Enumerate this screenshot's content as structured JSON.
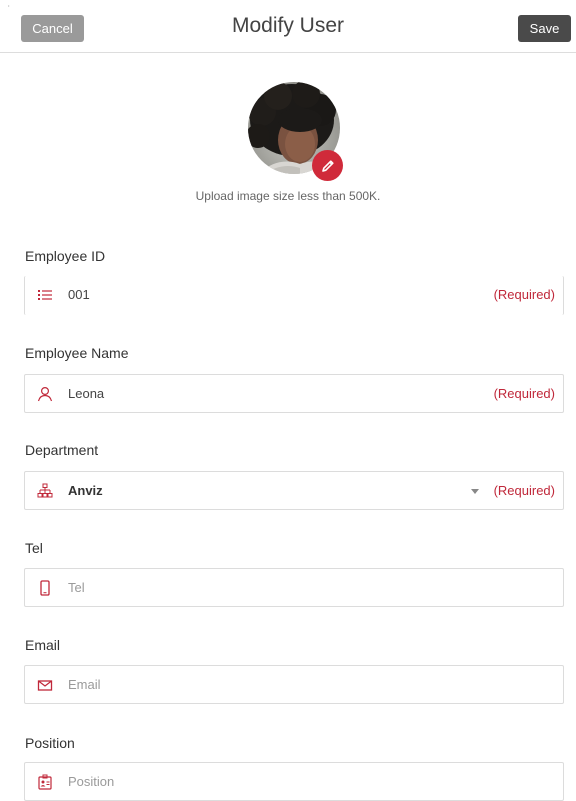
{
  "header": {
    "title": "Modify User",
    "cancel_label": "Cancel",
    "save_label": "Save"
  },
  "avatar": {
    "upload_hint": "Upload image size less than 500K.",
    "edit_icon": "pencil-icon"
  },
  "fields": {
    "employee_id": {
      "label": "Employee ID",
      "value": "001",
      "required": "(Required)",
      "icon": "list-icon"
    },
    "employee_name": {
      "label": "Employee Name",
      "value": "Leona",
      "required": "(Required)",
      "icon": "user-icon"
    },
    "department": {
      "label": "Department",
      "value": "Anviz",
      "required": "(Required)",
      "icon": "org-chart-icon"
    },
    "tel": {
      "label": "Tel",
      "placeholder": "Tel",
      "icon": "phone-icon"
    },
    "email": {
      "label": "Email",
      "placeholder": "Email",
      "icon": "envelope-icon"
    },
    "position": {
      "label": "Position",
      "placeholder": "Position",
      "icon": "id-badge-icon"
    }
  },
  "colors": {
    "accent": "#d02a3a",
    "required_text": "#c0283a",
    "cancel_bg": "#9a9a9a",
    "save_bg": "#4a4a4a"
  }
}
